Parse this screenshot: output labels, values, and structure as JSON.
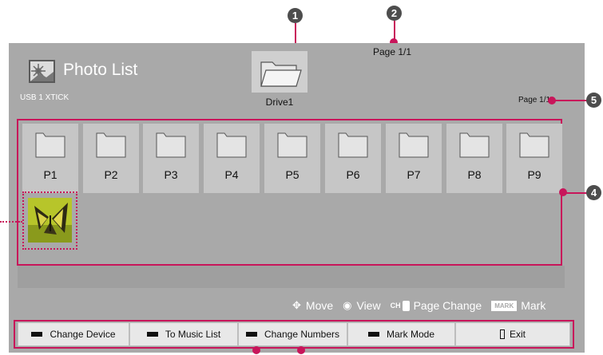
{
  "app": {
    "title": "Photo List",
    "device": "USB 1 XTICK",
    "drive": "Drive1",
    "page_top": "Page 1/1",
    "page_right": "Page 1/1"
  },
  "callouts": [
    "1",
    "2",
    "4",
    "5"
  ],
  "folders": [
    "P1",
    "P2",
    "P3",
    "P4",
    "P5",
    "P6",
    "P7",
    "P8",
    "P9"
  ],
  "hints": {
    "move": "Move",
    "view": "View",
    "ch": "CH",
    "page_change": "Page Change",
    "mark_key": "MARK",
    "mark": "Mark"
  },
  "buttons": {
    "change_device": "Change Device",
    "to_music_list": "To Music List",
    "change_numbers": "Change Numbers",
    "mark_mode": "Mark Mode",
    "exit": "Exit"
  },
  "colors": {
    "accent": "#c8155a",
    "screen_bg": "#a9a9a9",
    "callout": "#4d4d4d"
  }
}
